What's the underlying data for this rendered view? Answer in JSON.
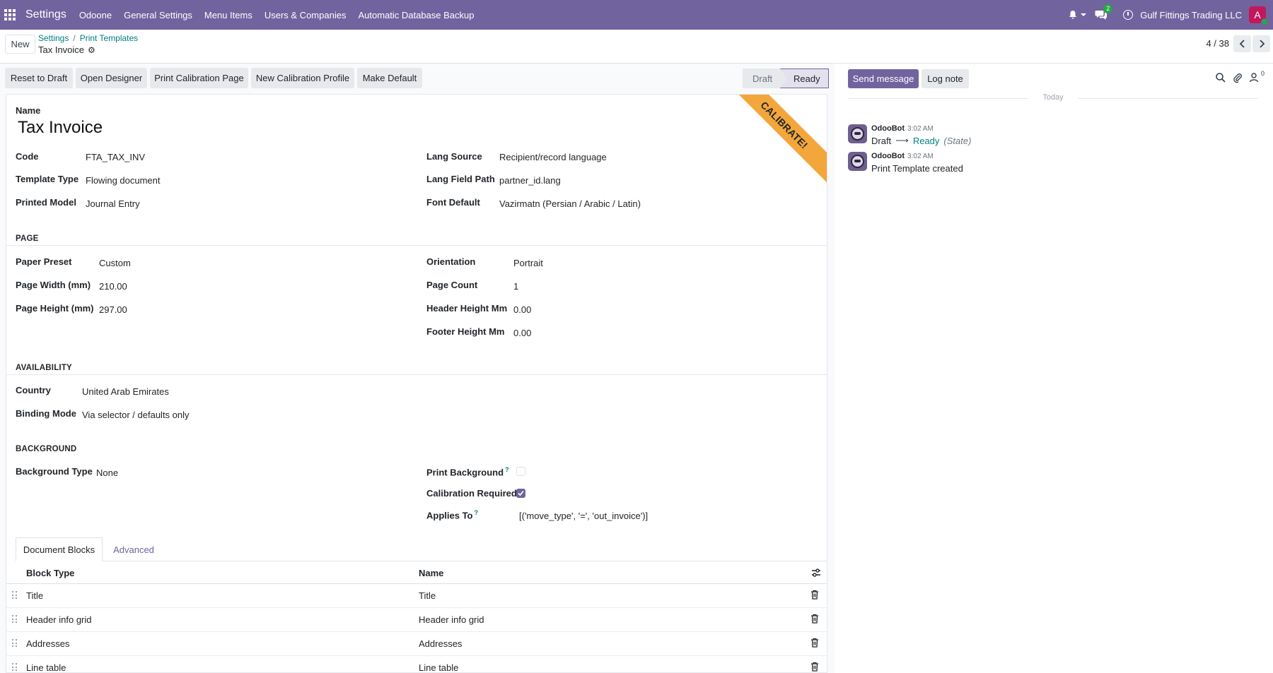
{
  "navbar": {
    "brand": "Settings",
    "menu": [
      "Odoone",
      "General Settings",
      "Menu Items",
      "Users & Companies",
      "Automatic Database Backup"
    ],
    "chat_badge": "2",
    "company": "Gulf Fittings Trading LLC",
    "avatar_letter": "A",
    "colors": {
      "navbar": "#71639e",
      "badge": "#28a745",
      "avatar": "#c2185b"
    }
  },
  "control": {
    "new_label": "New",
    "breadcrumb": [
      "Settings",
      "Print Templates"
    ],
    "record_title": "Tax Invoice",
    "pager": "4 / 38"
  },
  "actions": {
    "buttons": [
      "Reset to Draft",
      "Open Designer",
      "Print Calibration Page",
      "New Calibration Profile",
      "Make Default"
    ],
    "status": {
      "draft": "Draft",
      "ready": "Ready",
      "current": "Ready"
    }
  },
  "form": {
    "ribbon": "CALIBRATE!",
    "ribbon_color": "#f3a63b",
    "name_label": "Name",
    "name": "Tax Invoice",
    "header_left": [
      {
        "label": "Code",
        "value": "FTA_TAX_INV"
      },
      {
        "label": "Template Type",
        "value": "Flowing document"
      },
      {
        "label": "Printed Model",
        "value": "Journal Entry"
      }
    ],
    "header_right": [
      {
        "label": "Lang Source",
        "value": "Recipient/record language"
      },
      {
        "label": "Lang Field Path",
        "value": "partner_id.lang"
      },
      {
        "label": "Font Default",
        "value": "Vazirmatn (Persian / Arabic / Latin)"
      }
    ],
    "page_section": "PAGE",
    "page_left": [
      {
        "label": "Paper Preset",
        "value": "Custom"
      },
      {
        "label": "Page Width (mm)",
        "value": "210.00"
      },
      {
        "label": "Page Height (mm)",
        "value": "297.00"
      }
    ],
    "page_right": [
      {
        "label": "Orientation",
        "value": "Portrait"
      },
      {
        "label": "Page Count",
        "value": "1"
      },
      {
        "label": "Header Height Mm",
        "value": "0.00"
      },
      {
        "label": "Footer Height Mm",
        "value": "0.00"
      }
    ],
    "availability_section": "AVAILABILITY",
    "availability": [
      {
        "label": "Country",
        "value": "United Arab Emirates"
      },
      {
        "label": "Binding Mode",
        "value": "Via selector / defaults only"
      }
    ],
    "background_section": "BACKGROUND",
    "background_type": {
      "label": "Background Type",
      "value": "None"
    },
    "print_background": {
      "label": "Print Background",
      "help": "?",
      "checked": false
    },
    "calibration_required": {
      "label": "Calibration Required",
      "checked": true
    },
    "applies_to": {
      "label": "Applies To",
      "help": "?",
      "value": "[('move_type', '=', 'out_invoice')]"
    },
    "tabs": [
      "Document Blocks",
      "Advanced"
    ],
    "table": {
      "headers": [
        "Block Type",
        "Name"
      ],
      "rows": [
        {
          "block_type": "Title",
          "name": "Title"
        },
        {
          "block_type": "Header info grid",
          "name": "Header info grid"
        },
        {
          "block_type": "Addresses",
          "name": "Addresses"
        },
        {
          "block_type": "Line table",
          "name": "Line table"
        }
      ]
    }
  },
  "chatter": {
    "send_message": "Send message",
    "log_note": "Log note",
    "followers_count": "0",
    "date_separator": "Today",
    "messages": [
      {
        "author": "OdooBot",
        "time": "3:02 AM",
        "old_value": "Draft",
        "new_value": "Ready",
        "field": "(State)"
      },
      {
        "author": "OdooBot",
        "time": "3:02 AM",
        "body": "Print Template created"
      }
    ]
  }
}
